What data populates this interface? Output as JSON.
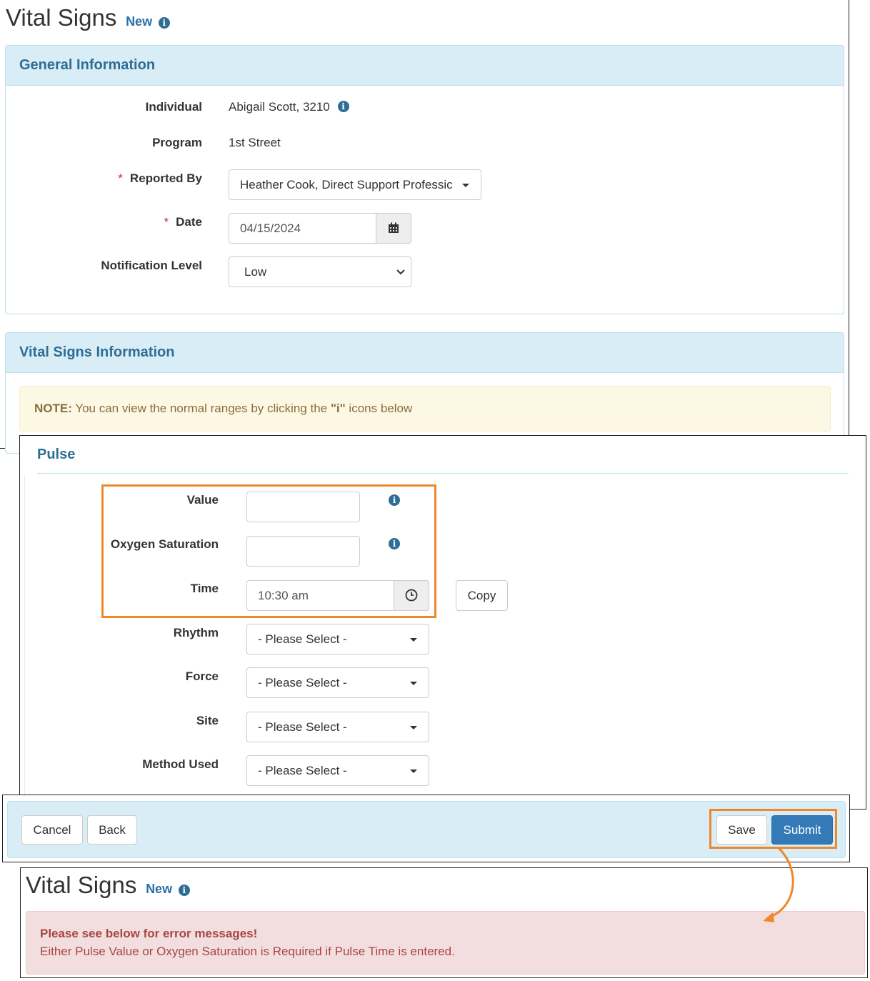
{
  "header": {
    "title": "Vital Signs",
    "badge": "New"
  },
  "general": {
    "title": "General Information",
    "individual_label": "Individual",
    "individual_value": "Abigail Scott, 3210",
    "program_label": "Program",
    "program_value": "1st Street",
    "reported_by_label": "Reported By",
    "reported_by_value": "Heather Cook, Direct Support Professic",
    "date_label": "Date",
    "date_value": "04/15/2024",
    "notification_label": "Notification Level",
    "notification_value": "Low",
    "required_mark": "*"
  },
  "vitals": {
    "title": "Vital Signs Information",
    "note_label": "NOTE:",
    "note_text_1": "You can view the normal ranges by clicking the",
    "note_quote": "\"i\"",
    "note_text_2": "icons below"
  },
  "pulse": {
    "title": "Pulse",
    "value_label": "Value",
    "value_value": "",
    "oxygen_label": "Oxygen Saturation",
    "oxygen_value": "",
    "time_label": "Time",
    "time_value": "10:30 am",
    "copy_label": "Copy",
    "rhythm_label": "Rhythm",
    "force_label": "Force",
    "site_label": "Site",
    "method_label": "Method Used",
    "select_placeholder": "- Please Select -"
  },
  "footer": {
    "cancel": "Cancel",
    "back": "Back",
    "save": "Save",
    "submit": "Submit"
  },
  "result": {
    "title": "Vital Signs",
    "badge": "New",
    "error_title": "Please see below for error messages!",
    "error_text": "Either Pulse Value or Oxygen Saturation is Required if Pulse Time is entered."
  },
  "colors": {
    "accent": "#2e6e94",
    "highlight": "#f0882a",
    "primary_button": "#337ab7",
    "error_bg": "#f2dede",
    "error_text": "#a94442",
    "note_bg": "#fcf8e3"
  },
  "icons": {
    "info": "info-circle-icon",
    "calendar": "calendar-icon",
    "clock": "clock-icon",
    "caret": "caret-down-icon",
    "chevron": "chevron-down-icon",
    "arrow": "curved-arrow-icon"
  }
}
